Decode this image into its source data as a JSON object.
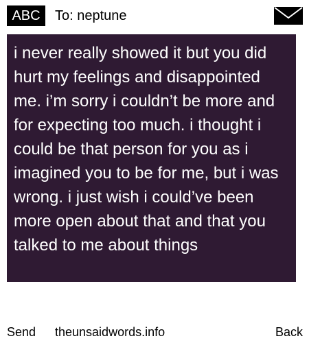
{
  "header": {
    "mode_label": "ABC",
    "recipient": "To: neptune",
    "envelope_icon": "envelope-icon"
  },
  "message": {
    "text": "i never really showed it but you did hurt my feelings and disappointed me. i’m sorry i couldn’t be more and for expecting too much. i thought i could be that person for you as i imagined you to be for me, but i was wrong. i just wish i could’ve been more open about that and that you talked to me about things"
  },
  "footer": {
    "send_label": "Send",
    "site": "theunsaidwords.info",
    "back_label": "Back"
  },
  "colors": {
    "message_background": "#2f1a33",
    "message_text": "#ffffff",
    "badge_background": "#000000"
  }
}
